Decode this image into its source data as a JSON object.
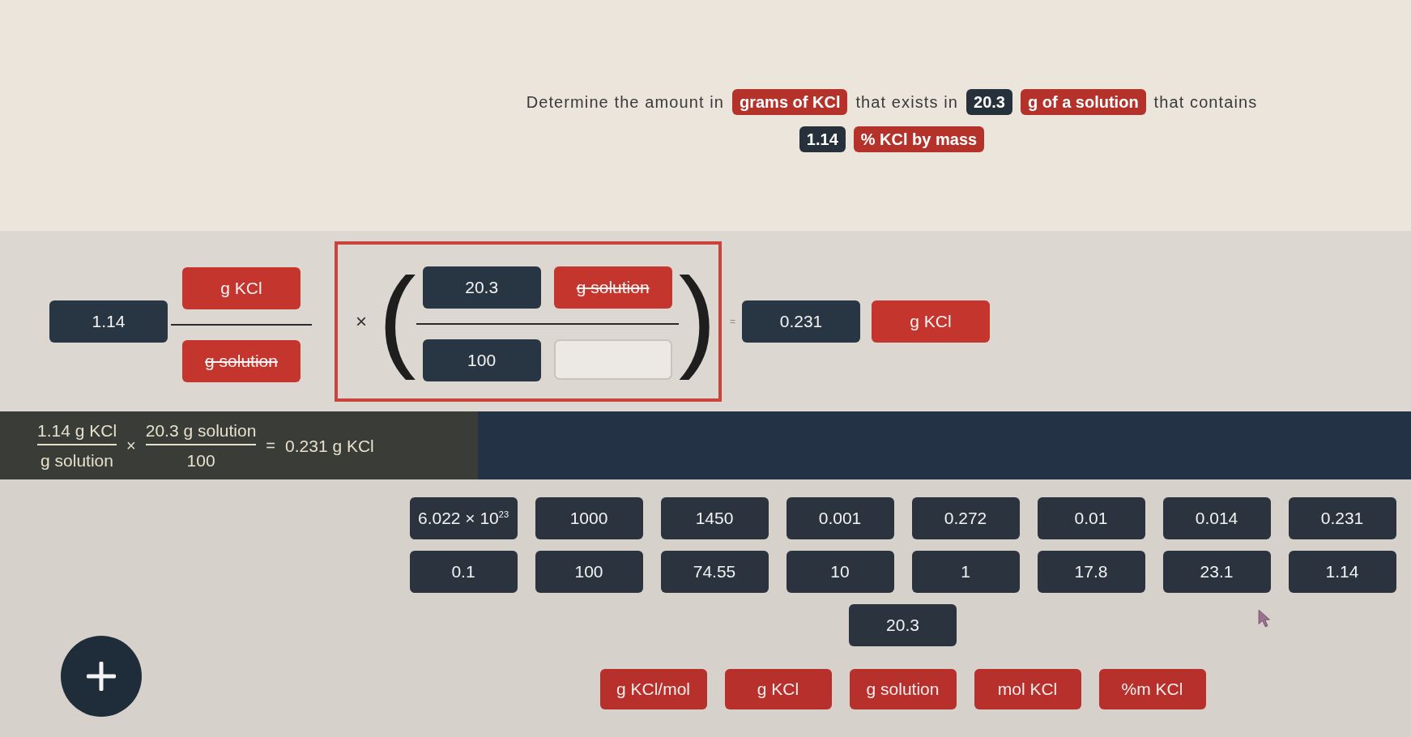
{
  "question": {
    "lines": [
      [
        {
          "kind": "text",
          "text": "Determine the amount in"
        },
        {
          "kind": "unit",
          "text": "grams of KCl"
        },
        {
          "kind": "text",
          "text": "that exists in"
        },
        {
          "kind": "number",
          "text": "20.3"
        },
        {
          "kind": "unit",
          "text": "g of a solution"
        },
        {
          "kind": "text",
          "text": "that contains"
        }
      ],
      [
        {
          "kind": "number",
          "text": "1.14"
        },
        {
          "kind": "unit",
          "text": "% KCl by mass"
        }
      ]
    ]
  },
  "equation": {
    "given": {
      "kind": "number",
      "text": "1.14"
    },
    "given_fraction": {
      "numerator": [
        {
          "kind": "unit",
          "text": "g KCl",
          "cancelled": false
        }
      ],
      "denominator": [
        {
          "kind": "unit",
          "text": "g solution",
          "cancelled": true
        }
      ]
    },
    "factor": {
      "highlighted": true,
      "operator": "×",
      "open_paren": "(",
      "close_paren": ")",
      "numerator": [
        {
          "kind": "number",
          "text": "20.3",
          "cancelled": false
        },
        {
          "kind": "unit",
          "text": "g solution",
          "cancelled": true
        }
      ],
      "denominator": [
        {
          "kind": "number",
          "text": "100",
          "cancelled": false
        },
        {
          "kind": "blank"
        }
      ]
    },
    "equals": "=",
    "answer": [
      {
        "kind": "number",
        "text": "0.231"
      },
      {
        "kind": "unit",
        "text": "g KCl"
      }
    ]
  },
  "worked_solution": {
    "terms": [
      {
        "kind": "fraction",
        "numerator": "1.14 g KCl",
        "denominator": "g solution"
      },
      {
        "kind": "operator",
        "text": "×"
      },
      {
        "kind": "fraction",
        "numerator": "20.3 g solution",
        "denominator": "100"
      },
      {
        "kind": "operator",
        "text": "="
      },
      {
        "kind": "text",
        "text": "0.231 g KCl"
      }
    ]
  },
  "number_tiles": [
    "6.022 × 10$^{23}$",
    "1000",
    "1450",
    "0.001",
    "0.272",
    "0.01",
    "0.014",
    "0.231",
    "0.1",
    "100",
    "74.55",
    "10",
    "1",
    "17.8",
    "23.1",
    "1.14",
    "20.3"
  ],
  "unit_tiles": [
    "g KCl/mol",
    "g KCl",
    "g solution",
    "mol KCl",
    "%m KCl"
  ]
}
